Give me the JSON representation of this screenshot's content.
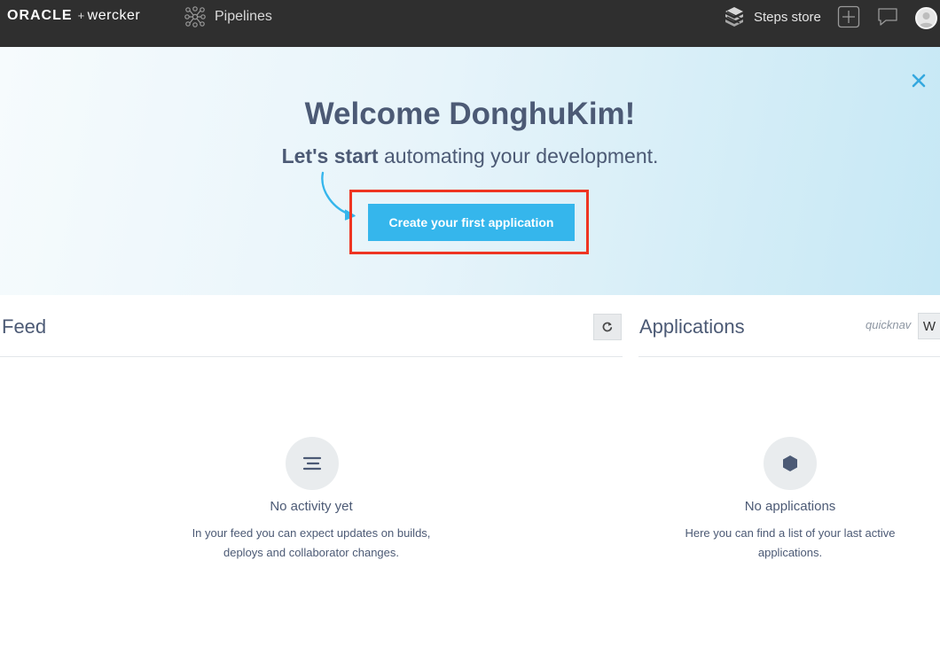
{
  "nav": {
    "logo_oracle": "ORACLE",
    "logo_plus": "+",
    "logo_wercker": "wercker",
    "pipelines_label": "Pipelines",
    "steps_store_label": "Steps store"
  },
  "hero": {
    "title": "Welcome DonghuKim!",
    "subtitle_bold": "Let's start",
    "subtitle_rest": " automating your development.",
    "cta_label": "Create your first application",
    "highlight_color": "#ee3522",
    "cta_color": "#35b6ec"
  },
  "feed": {
    "title": "Feed",
    "empty_title": "No activity yet",
    "empty_line1": "In your feed you can expect updates on builds,",
    "empty_line2": "deploys and collaborator changes."
  },
  "applications": {
    "title": "Applications",
    "quicknav_label": "quicknav",
    "quicknav_key": "W",
    "empty_title": "No applications",
    "empty_line1": "Here you can find a list of your last active",
    "empty_line2": "applications."
  },
  "icons": {
    "pipelines": "pipelines-icon",
    "steps_store": "steps-store-icon",
    "add": "plus-icon",
    "chat": "chat-bubble-icon",
    "avatar": "user-avatar",
    "close": "close-icon",
    "refresh": "refresh-icon",
    "feed_empty": "lines-icon",
    "apps_empty": "hexagon-icon"
  }
}
